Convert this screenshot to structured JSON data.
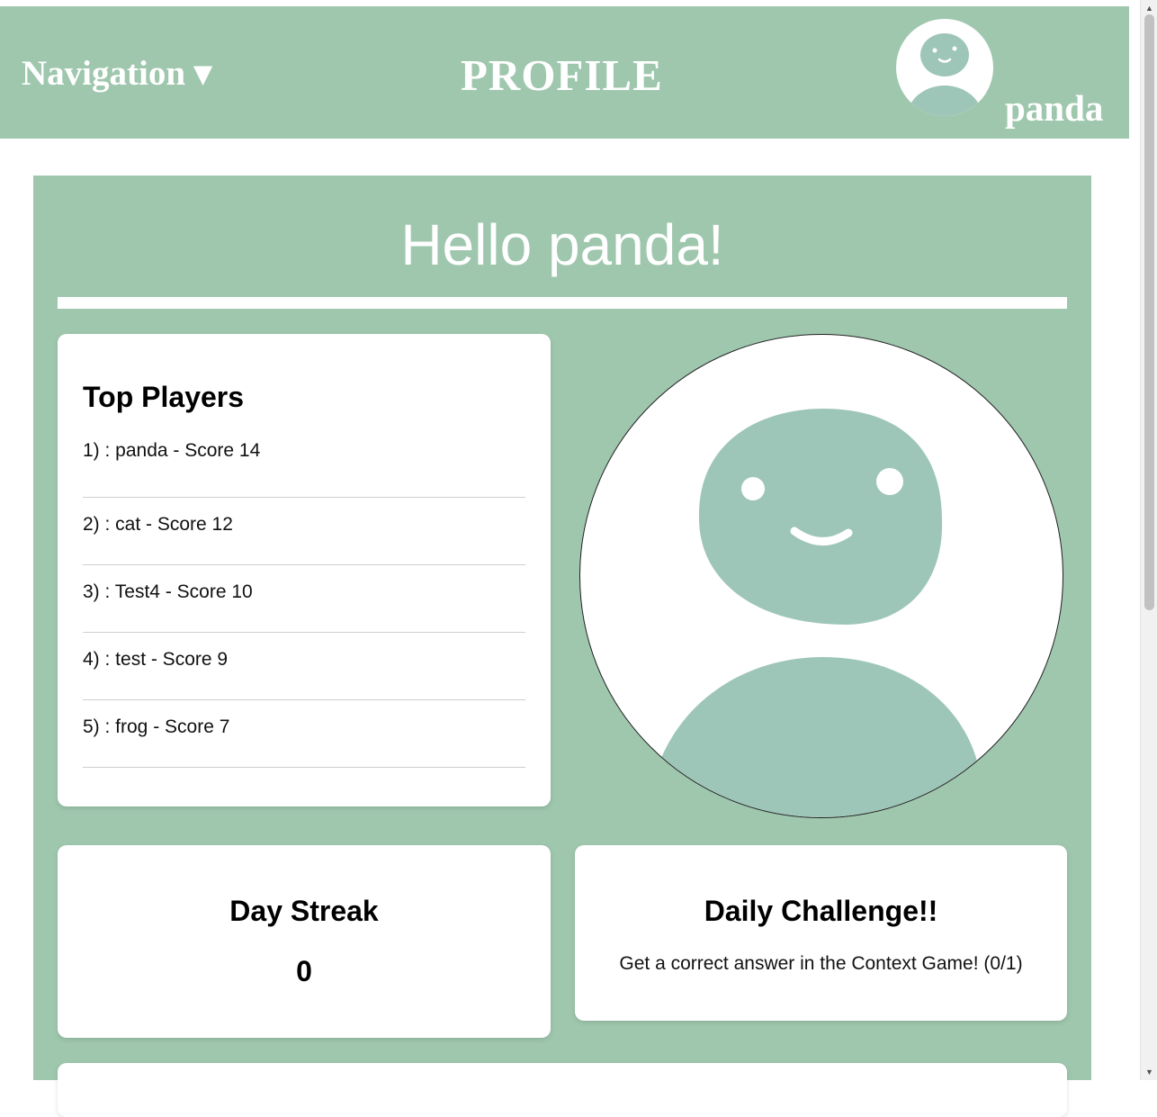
{
  "header": {
    "nav_label": "Navigation ▾",
    "title": "PROFILE",
    "username": "panda",
    "avatar_icon": "user-avatar-icon"
  },
  "main": {
    "greeting": "Hello panda!",
    "top_players": {
      "title": "Top Players",
      "players": [
        "1) : panda - Score 14",
        "2) : cat - Score 12",
        "3) : Test4 - Score 10",
        "4) : test - Score 9",
        "5) : frog - Score 7"
      ]
    },
    "streak": {
      "title": "Day Streak",
      "value": "0"
    },
    "challenge": {
      "title": "Daily Challenge!!",
      "text": "Get a correct answer in the Context Game! (0/1)"
    }
  },
  "colors": {
    "accent": "#9fc7ae",
    "avatar": "#9ec6b8",
    "card": "#ffffff"
  }
}
